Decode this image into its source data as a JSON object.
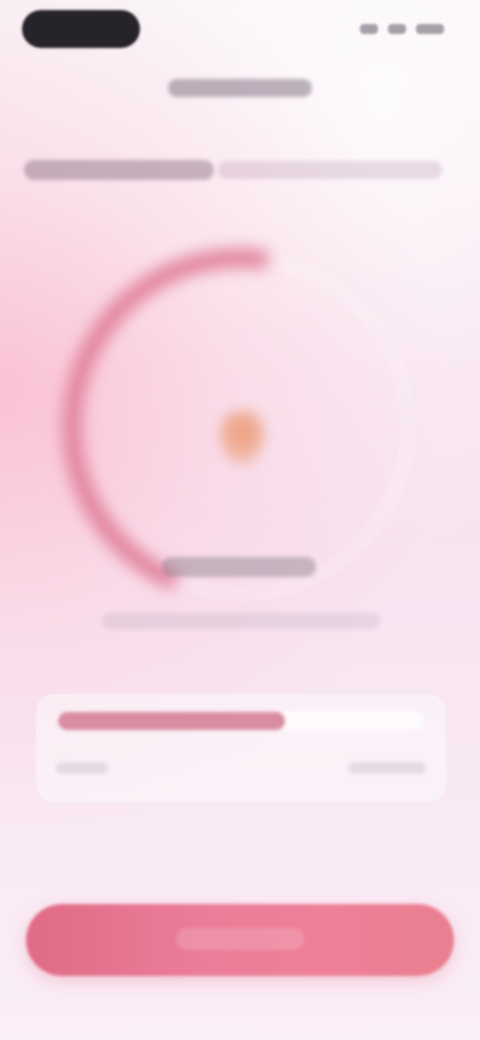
{
  "status_bar": {
    "time": "",
    "signal_icon": "signal-icon",
    "wifi_icon": "wifi-icon",
    "battery_icon": "battery-icon"
  },
  "header": {
    "title": ""
  },
  "intro": {
    "primary_text": "",
    "secondary_text": ""
  },
  "gauge": {
    "progress": 0.45,
    "accent_color": "#e07b97",
    "icon": "water-drop-icon",
    "icon_color": "#efa183"
  },
  "status": {
    "title": "",
    "description": ""
  },
  "progress_card": {
    "value": 0.62,
    "left_label": "",
    "right_label": "",
    "fill_color": "#d98ca2"
  },
  "primary_button": {
    "label": "",
    "color": "#e97892"
  }
}
